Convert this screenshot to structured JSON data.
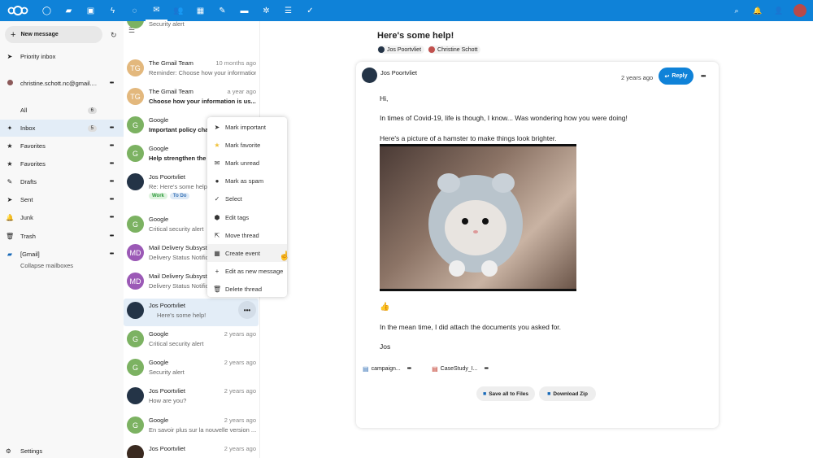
{
  "colors": {
    "header": "#0f82d8",
    "accent": "#0f82d8",
    "selected_row": "#e3edf7"
  },
  "header": {
    "apps": [
      "dashboard-icon",
      "files-icon",
      "photos-icon",
      "activity-icon",
      "talk-icon",
      "mail-icon",
      "contacts-icon",
      "calendar-icon",
      "notes-icon",
      "deck-icon",
      "tasks-icon",
      "checklist-icon",
      "done-icon"
    ],
    "right": [
      "search-icon",
      "notifications-icon",
      "contacts-menu-icon",
      "user-avatar"
    ]
  },
  "sidebar": {
    "new_message": "New message",
    "priority_inbox": "Priority inbox",
    "account": "christine.schott.nc@gmail....",
    "items": [
      {
        "label": "All",
        "badge": "6"
      },
      {
        "label": "Inbox",
        "badge": "5"
      },
      {
        "label": "Favorites"
      },
      {
        "label": "Favorites"
      },
      {
        "label": "Drafts"
      },
      {
        "label": "Sent"
      },
      {
        "label": "Junk"
      },
      {
        "label": "Trash"
      },
      {
        "label": "[Gmail]"
      }
    ],
    "collapse": "Collapse mailboxes",
    "settings": "Settings"
  },
  "messages": [
    {
      "sender": "",
      "subject": "Security alert",
      "date": "",
      "initials": "",
      "color": "#7cb262"
    },
    {
      "sender": "The Gmail Team",
      "subject": "Reminder: Choose how your information...",
      "date": "10 months ago",
      "initials": "TG",
      "color": "#e3b87d"
    },
    {
      "sender": "The Gmail Team",
      "subject": "Choose how your information is us...",
      "date": "a year ago",
      "initials": "TG",
      "color": "#e3b87d",
      "unread": true
    },
    {
      "sender": "Google",
      "subject": "Important policy chan...",
      "date": "",
      "initials": "G",
      "color": "#7cb262",
      "unread": true
    },
    {
      "sender": "Google",
      "subject": "Help strengthen the s...",
      "date": "",
      "initials": "G",
      "color": "#7cb262",
      "unread": true
    },
    {
      "sender": "Jos Poortvliet",
      "subject": "Re: Here's some help!",
      "date": "",
      "initials": "",
      "color": "#243447",
      "tags": [
        "Work",
        "To Do"
      ]
    },
    {
      "sender": "Google",
      "subject": "Critical security alert",
      "date": "",
      "initials": "G",
      "color": "#7cb262"
    },
    {
      "sender": "Mail Delivery Subsyste...",
      "subject": "Delivery Status Notific...",
      "date": "",
      "initials": "MD",
      "color": "#9b59b6"
    },
    {
      "sender": "Mail Delivery Subsyste...",
      "subject": "Delivery Status Notific...",
      "date": "",
      "initials": "MD",
      "color": "#9b59b6"
    },
    {
      "sender": "Jos Poortvliet",
      "subject": "Here's some help!",
      "date": "",
      "initials": "",
      "color": "#243447",
      "selected": true
    },
    {
      "sender": "Google",
      "subject": "Critical security alert",
      "date": "2 years ago",
      "initials": "G",
      "color": "#7cb262"
    },
    {
      "sender": "Google",
      "subject": "Security alert",
      "date": "2 years ago",
      "initials": "G",
      "color": "#7cb262"
    },
    {
      "sender": "Jos Poortvliet",
      "subject": "How are you?",
      "date": "2 years ago",
      "initials": "",
      "color": "#243447"
    },
    {
      "sender": "Google",
      "subject": "En savoir plus sur la nouvelle version ...",
      "date": "2 years ago",
      "initials": "G",
      "color": "#7cb262"
    },
    {
      "sender": "Jos Poortvliet",
      "subject": "",
      "date": "2 years ago",
      "initials": "",
      "color": "#3a2a20"
    }
  ],
  "context_menu": [
    {
      "label": "Mark important",
      "icon": "important-icon"
    },
    {
      "label": "Mark favorite",
      "icon": "star-icon"
    },
    {
      "label": "Mark unread",
      "icon": "envelope-icon"
    },
    {
      "label": "Mark as spam",
      "icon": "spam-icon"
    },
    {
      "label": "Select",
      "icon": "check-icon"
    },
    {
      "label": "Edit tags",
      "icon": "tag-icon"
    },
    {
      "label": "Move thread",
      "icon": "move-icon"
    },
    {
      "label": "Create event",
      "icon": "calendar-icon"
    },
    {
      "label": "Edit as new message",
      "icon": "plus-icon"
    },
    {
      "label": "Delete thread",
      "icon": "trash-icon"
    }
  ],
  "thread": {
    "title": "Here's some help!",
    "participants": [
      "Jos Poortvliet",
      "Christine Schott"
    ],
    "sender": "Jos Poortvliet",
    "date": "2 years ago",
    "reply": "Reply",
    "body": [
      "Hi,",
      "In times of Covid-19, life is though, I know... Was wondering how you were doing!",
      "Here's a picture of a hamster to make things look brighter.",
      "👍",
      "In the mean time, I did attach the documents you asked for.",
      "Jos"
    ],
    "attachments": [
      "campaign...",
      "CaseStudy_I..."
    ],
    "save_all": "Save all to Files",
    "download_zip": "Download Zip"
  }
}
